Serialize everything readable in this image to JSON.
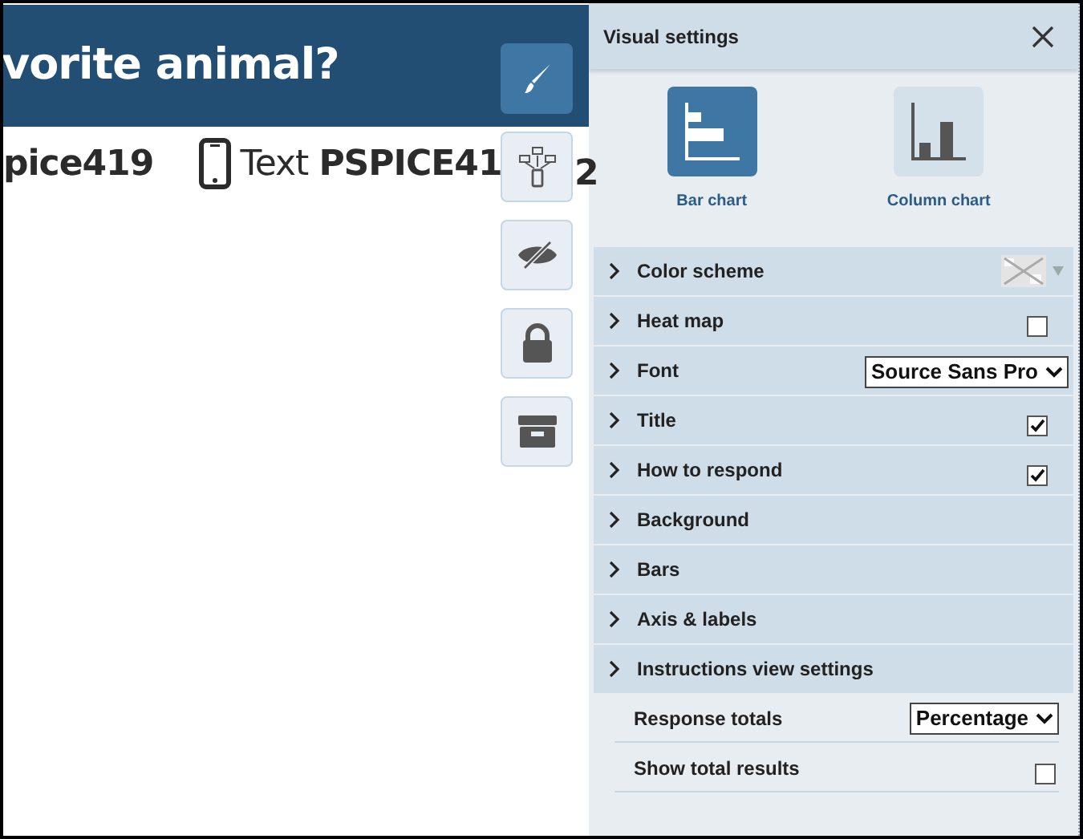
{
  "question_header": {
    "title": "vorite animal?"
  },
  "instructions": {
    "code_fragment": "pice419",
    "text_label": "Text",
    "keyword": "PSPICE41",
    "trailing": "2"
  },
  "toolbar": [
    {
      "kind": "brush",
      "selected": true
    },
    {
      "kind": "network",
      "selected": false
    },
    {
      "kind": "hidden",
      "selected": false
    },
    {
      "kind": "lock",
      "selected": false
    },
    {
      "kind": "archive",
      "selected": false
    }
  ],
  "panel": {
    "title": "Visual settings",
    "chart_types": [
      {
        "label": "Bar chart",
        "kind": "bar",
        "selected": true
      },
      {
        "label": "Column chart",
        "kind": "column",
        "selected": false
      }
    ],
    "sections": [
      {
        "label": "Color scheme",
        "kind": "swatch"
      },
      {
        "label": "Heat map",
        "kind": "checkbox",
        "checked": false
      },
      {
        "label": "Font",
        "kind": "select",
        "value": "Source Sans Pro"
      },
      {
        "label": "Title",
        "kind": "checkbox",
        "checked": true
      },
      {
        "label": "How to respond",
        "kind": "checkbox",
        "checked": true
      },
      {
        "label": "Background",
        "kind": "plain"
      },
      {
        "label": "Bars",
        "kind": "plain"
      },
      {
        "label": "Axis & labels",
        "kind": "plain"
      },
      {
        "label": "Instructions view settings",
        "kind": "plain"
      }
    ],
    "instruction_options": [
      {
        "label": "Response totals",
        "kind": "select",
        "value": "Percentage"
      },
      {
        "label": "Show total results",
        "kind": "checkbox",
        "checked": false
      }
    ]
  }
}
